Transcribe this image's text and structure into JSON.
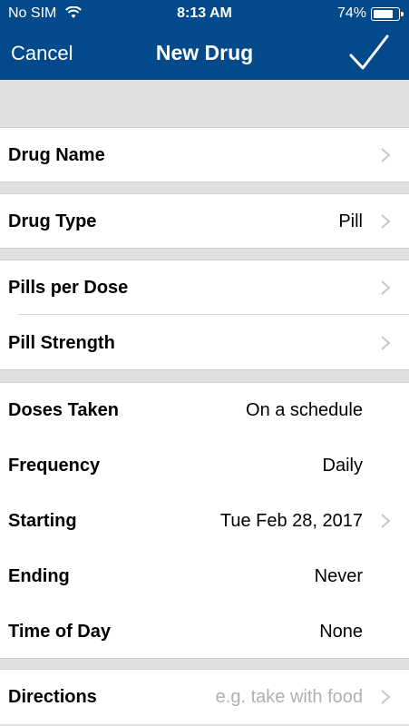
{
  "status_bar": {
    "carrier": "No SIM",
    "time": "8:13 AM",
    "battery_percent": "74%",
    "battery_level": 0.74
  },
  "nav": {
    "cancel_label": "Cancel",
    "title": "New Drug",
    "done_icon": "checkmark-icon"
  },
  "colors": {
    "nav_background": "#034a8c",
    "group_background": "#e0e0e0",
    "placeholder_text": "#b0b0b0",
    "chevron": "#c7c7cc"
  },
  "form": {
    "drug_name": {
      "label": "Drug Name",
      "value": ""
    },
    "drug_type": {
      "label": "Drug Type",
      "value": "Pill"
    },
    "pills_per_dose": {
      "label": "Pills per Dose",
      "value": ""
    },
    "pill_strength": {
      "label": "Pill Strength",
      "value": ""
    },
    "doses_taken": {
      "label": "Doses Taken",
      "value": "On a schedule"
    },
    "frequency": {
      "label": "Frequency",
      "value": "Daily"
    },
    "starting": {
      "label": "Starting",
      "value": "Tue Feb 28, 2017"
    },
    "ending": {
      "label": "Ending",
      "value": "Never"
    },
    "time_of_day": {
      "label": "Time of Day",
      "value": "None"
    },
    "directions": {
      "label": "Directions",
      "placeholder": "e.g. take with food"
    }
  }
}
